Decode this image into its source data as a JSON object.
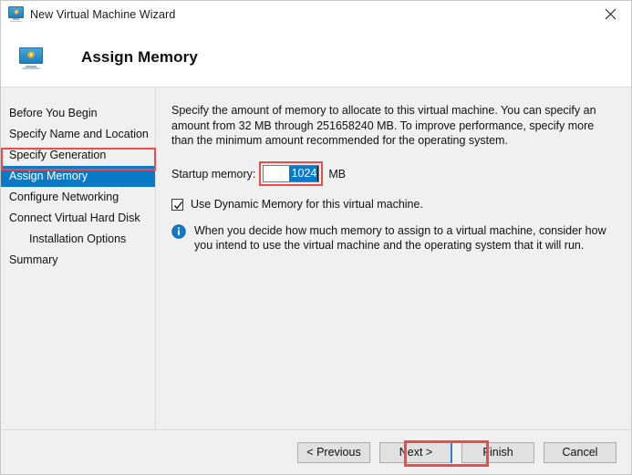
{
  "window": {
    "title": "New Virtual Machine Wizard",
    "title_icon": "virtual-machine-monitor-icon",
    "close_icon": "close-icon"
  },
  "header": {
    "icon": "virtual-machine-monitor-icon",
    "title": "Assign Memory"
  },
  "sidebar": {
    "items": [
      {
        "label": "Before You Begin",
        "selected": false,
        "indented": false
      },
      {
        "label": "Specify Name and Location",
        "selected": false,
        "indented": false
      },
      {
        "label": "Specify Generation",
        "selected": false,
        "indented": false
      },
      {
        "label": "Assign Memory",
        "selected": true,
        "indented": false
      },
      {
        "label": "Configure Networking",
        "selected": false,
        "indented": false
      },
      {
        "label": "Connect Virtual Hard Disk",
        "selected": false,
        "indented": false
      },
      {
        "label": "Installation Options",
        "selected": false,
        "indented": true
      },
      {
        "label": "Summary",
        "selected": false,
        "indented": false
      }
    ]
  },
  "main": {
    "description": "Specify the amount of memory to allocate to this virtual machine. You can specify an amount from 32 MB through 251658240 MB. To improve performance, specify more than the minimum amount recommended for the operating system.",
    "startup_memory_label": "Startup memory:",
    "startup_memory_value": "1024",
    "startup_memory_unit": "MB",
    "dynamic_memory_label": "Use Dynamic Memory for this virtual machine.",
    "dynamic_memory_checked": "checked",
    "info_icon": "info-icon",
    "info_text": "When you decide how much memory to assign to a virtual machine, consider how you intend to use the virtual machine and the operating system that it will run."
  },
  "footer": {
    "previous_label": "< Previous",
    "next_label": "Next >",
    "finish_label": "Finish",
    "cancel_label": "Cancel"
  },
  "colors": {
    "selection_blue": "#0a7ac8",
    "highlight_red": "#f04b4b",
    "dialog_gray": "#f0f0f0",
    "button_face": "#e1e1e1",
    "focus_blue": "#2f7fd1",
    "info_blue": "#1478c8"
  }
}
